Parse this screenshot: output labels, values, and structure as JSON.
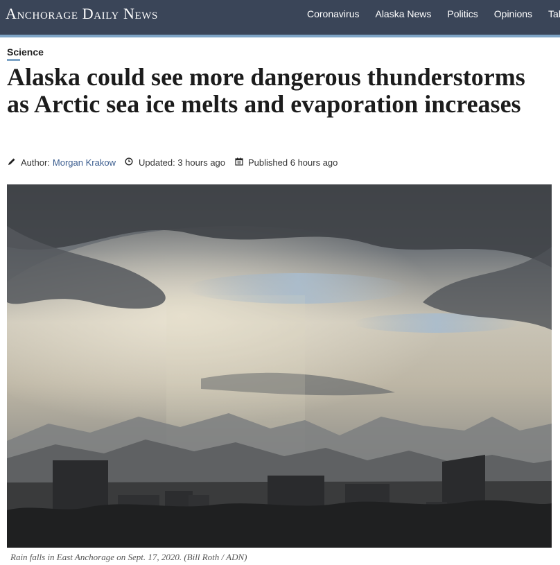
{
  "site": {
    "logo_text": "Anchorage Daily News",
    "nav_items": [
      "Coronavirus",
      "Alaska News",
      "Politics",
      "Opinions",
      "Talk"
    ],
    "colors": {
      "header_bg": "#3a4558",
      "accent": "#7ea4c6",
      "link": "#3b5d8f"
    }
  },
  "article": {
    "section": "Science",
    "headline": "Alaska could see more dangerous thunderstorms as Arctic sea ice melts and evaporation increases",
    "author_prefix": "Author:",
    "author_name": "Morgan Krakow",
    "updated": "Updated: 3 hours ago",
    "published": "Published 6 hours ago",
    "icons": {
      "author": "pencil-icon",
      "updated": "clock-icon",
      "published": "calendar-icon"
    }
  },
  "photo": {
    "caption": "Rain falls in East Anchorage on Sept. 17, 2020. (Bill Roth / ADN)"
  }
}
